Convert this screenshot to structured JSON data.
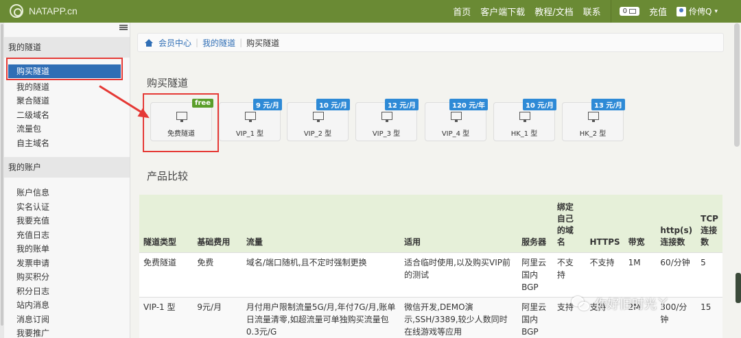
{
  "navbar": {
    "brand": "NATAPP.cn",
    "links": [
      "首页",
      "客户端下载",
      "教程/文档",
      "联系"
    ],
    "cart_count": "0",
    "recharge": "充值",
    "user": "伶俜Q",
    "user_caret": "▾"
  },
  "sidebar": {
    "section1_title": "我的隧道",
    "section1_items": [
      "购买隧道",
      "我的隧道",
      "聚合隧道",
      "二级域名",
      "流量包",
      "自主域名"
    ],
    "section2_title": "我的账户",
    "section2_items": [
      "账户信息",
      "实名认证",
      "我要充值",
      "充值日志",
      "我的账单",
      "发票申请",
      "购买积分",
      "积分日志",
      "站内消息",
      "消息订阅",
      "我要推广"
    ]
  },
  "breadcrumb": {
    "items": [
      "会员中心",
      "我的隧道"
    ],
    "current": "购买隧道"
  },
  "buy_section": {
    "title": "购买隧道",
    "plans": [
      {
        "name": "免费隧道",
        "price": "free"
      },
      {
        "name": "VIP_1 型",
        "price": "9 元/月"
      },
      {
        "name": "VIP_2 型",
        "price": "10 元/月"
      },
      {
        "name": "VIP_3 型",
        "price": "12 元/月"
      },
      {
        "name": "VIP_4 型",
        "price": "120 元/年"
      },
      {
        "name": "HK_1 型",
        "price": "10 元/月"
      },
      {
        "name": "HK_2 型",
        "price": "13 元/月"
      }
    ]
  },
  "compare_section": {
    "title": "产品比较",
    "headers": [
      "隧道类型",
      "基础费用",
      "流量",
      "适用",
      "服务器",
      "绑定自己的域名",
      "HTTPS",
      "带宽",
      "http(s) 连接数",
      "TCP 连接数"
    ],
    "rows": [
      [
        "免费隧道",
        "免费",
        "域名/端口随机,且不定时强制更换",
        "适合临时使用,以及购买VIP前的测试",
        "阿里云国内BGP",
        "不支持",
        "不支持",
        "1M",
        "60/分钟",
        "5"
      ],
      [
        "VIP-1 型",
        "9元/月",
        "月付用户限制流量5G/月,年付7G/月,账单日流量清零,如超流量可单独购买流量包 0.3元/G",
        "微信开发,DEMO演示,SSH/3389,较少人数同时在线游戏等应用",
        "阿里云国内BGP",
        "支持",
        "支持",
        "2M",
        "300/分钟",
        "15"
      ]
    ]
  },
  "watermark": "你好旧时光丫"
}
